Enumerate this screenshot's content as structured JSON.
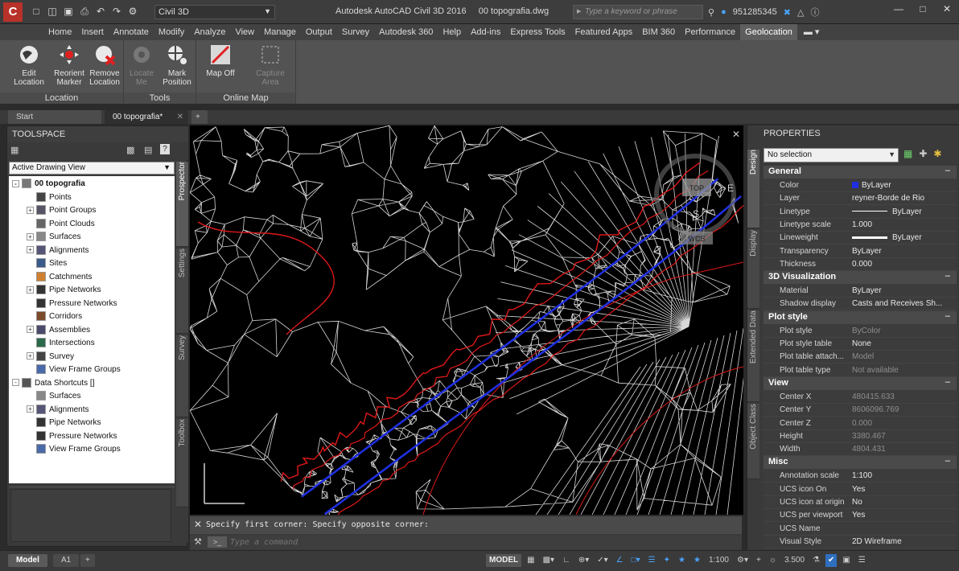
{
  "app": {
    "title": "Autodesk AutoCAD Civil 3D 2016",
    "document": "00 topografia.dwg",
    "workspace": "Civil 3D",
    "search_placeholder": "Type a keyword or phrase",
    "user_id": "951285345",
    "logo_letter": "C"
  },
  "ribbon_tabs": [
    {
      "label": "Home"
    },
    {
      "label": "Insert"
    },
    {
      "label": "Annotate"
    },
    {
      "label": "Modify"
    },
    {
      "label": "Analyze"
    },
    {
      "label": "View"
    },
    {
      "label": "Manage"
    },
    {
      "label": "Output"
    },
    {
      "label": "Survey"
    },
    {
      "label": "Autodesk 360"
    },
    {
      "label": "Help"
    },
    {
      "label": "Add-ins"
    },
    {
      "label": "Express Tools"
    },
    {
      "label": "Featured Apps"
    },
    {
      "label": "BIM 360"
    },
    {
      "label": "Performance"
    },
    {
      "label": "Geolocation",
      "active": true
    }
  ],
  "ribbon": {
    "location": {
      "label": "Location",
      "edit": "Edit Location",
      "reorient": "Reorient Marker",
      "remove": "Remove Location"
    },
    "tools": {
      "label": "Tools",
      "locate": "Locate Me",
      "mark": "Mark Position"
    },
    "online_map": {
      "label": "Online Map",
      "map_off": "Map Off",
      "capture": "Capture Area"
    }
  },
  "doc_tabs": {
    "start": "Start",
    "active": "00 topografia*"
  },
  "toolspace": {
    "title": "TOOLSPACE",
    "view": "Active Drawing View",
    "tree": [
      {
        "label": "00 topografia",
        "level": 0,
        "exp": "-",
        "bold": true,
        "icon": "drawing-icon"
      },
      {
        "label": "Points",
        "level": 1,
        "exp": "",
        "icon": "points-icon"
      },
      {
        "label": "Point Groups",
        "level": 1,
        "exp": "+",
        "icon": "point-groups-icon"
      },
      {
        "label": "Point Clouds",
        "level": 1,
        "exp": "",
        "icon": "point-clouds-icon"
      },
      {
        "label": "Surfaces",
        "level": 1,
        "exp": "+",
        "icon": "surfaces-icon"
      },
      {
        "label": "Alignments",
        "level": 1,
        "exp": "+",
        "icon": "alignments-icon"
      },
      {
        "label": "Sites",
        "level": 1,
        "exp": "",
        "icon": "sites-icon"
      },
      {
        "label": "Catchments",
        "level": 1,
        "exp": "",
        "icon": "catchments-icon"
      },
      {
        "label": "Pipe Networks",
        "level": 1,
        "exp": "+",
        "icon": "pipe-networks-icon"
      },
      {
        "label": "Pressure Networks",
        "level": 1,
        "exp": "",
        "icon": "pressure-networks-icon"
      },
      {
        "label": "Corridors",
        "level": 1,
        "exp": "",
        "icon": "corridors-icon"
      },
      {
        "label": "Assemblies",
        "level": 1,
        "exp": "+",
        "icon": "assemblies-icon"
      },
      {
        "label": "Intersections",
        "level": 1,
        "exp": "",
        "icon": "intersections-icon"
      },
      {
        "label": "Survey",
        "level": 1,
        "exp": "+",
        "icon": "survey-icon"
      },
      {
        "label": "View Frame Groups",
        "level": 1,
        "exp": "",
        "icon": "view-frame-groups-icon"
      },
      {
        "label": "Data Shortcuts []",
        "level": 0,
        "exp": "-",
        "bold": false,
        "icon": "data-shortcuts-icon"
      },
      {
        "label": "Surfaces",
        "level": 1,
        "exp": "",
        "icon": "surfaces-icon"
      },
      {
        "label": "Alignments",
        "level": 1,
        "exp": "+",
        "icon": "alignments-icon"
      },
      {
        "label": "Pipe Networks",
        "level": 1,
        "exp": "",
        "icon": "pipe-networks-icon"
      },
      {
        "label": "Pressure Networks",
        "level": 1,
        "exp": "",
        "icon": "pressure-networks-icon"
      },
      {
        "label": "View Frame Groups",
        "level": 1,
        "exp": "",
        "icon": "view-frame-groups-icon"
      }
    ],
    "side_tabs": [
      "Prospector",
      "Settings",
      "Survey",
      "Toolbox"
    ]
  },
  "viewport": {
    "viewcube_top": "TOP",
    "compass_e": "E",
    "compass_s": "S",
    "wcs": "WCS"
  },
  "command": {
    "history": "Specify first corner: Specify opposite corner:",
    "placeholder": "Type a command"
  },
  "properties": {
    "title": "PROPERTIES",
    "selection": "No selection",
    "side_tabs": [
      "Design",
      "Display",
      "Extended Data",
      "Object Class"
    ],
    "categories": [
      {
        "name": "General",
        "rows": [
          {
            "k": "Color",
            "v": "ByLayer",
            "swatch": "#1f2fe0"
          },
          {
            "k": "Layer",
            "v": "reyner-Borde de Rio"
          },
          {
            "k": "Linetype",
            "v": "ByLayer",
            "line": "thin"
          },
          {
            "k": "Linetype scale",
            "v": "1.000"
          },
          {
            "k": "Lineweight",
            "v": "ByLayer",
            "line": "thick"
          },
          {
            "k": "Transparency",
            "v": "ByLayer"
          },
          {
            "k": "Thickness",
            "v": "0.000"
          }
        ]
      },
      {
        "name": "3D Visualization",
        "rows": [
          {
            "k": "Material",
            "v": "ByLayer"
          },
          {
            "k": "Shadow display",
            "v": "Casts and Receives Sh..."
          }
        ]
      },
      {
        "name": "Plot style",
        "rows": [
          {
            "k": "Plot style",
            "v": "ByColor",
            "dim": true
          },
          {
            "k": "Plot style table",
            "v": "None"
          },
          {
            "k": "Plot table attach...",
            "v": "Model",
            "dim": true
          },
          {
            "k": "Plot table type",
            "v": "Not available",
            "dim": true
          }
        ]
      },
      {
        "name": "View",
        "rows": [
          {
            "k": "Center X",
            "v": "480415.633",
            "dim": true
          },
          {
            "k": "Center Y",
            "v": "8606096.769",
            "dim": true
          },
          {
            "k": "Center Z",
            "v": "0.000",
            "dim": true
          },
          {
            "k": "Height",
            "v": "3380.467",
            "dim": true
          },
          {
            "k": "Width",
            "v": "4804.431",
            "dim": true
          }
        ]
      },
      {
        "name": "Misc",
        "rows": [
          {
            "k": "Annotation scale",
            "v": "1:100"
          },
          {
            "k": "UCS icon On",
            "v": "Yes"
          },
          {
            "k": "UCS icon at origin",
            "v": "No"
          },
          {
            "k": "UCS per viewport",
            "v": "Yes"
          },
          {
            "k": "UCS Name",
            "v": ""
          },
          {
            "k": "Visual Style",
            "v": "2D Wireframe"
          }
        ]
      }
    ]
  },
  "status": {
    "tabs": [
      "Model",
      "A1"
    ],
    "model": "MODEL",
    "scale": "1:100",
    "value": "3.500"
  },
  "colors": {
    "accent_blue": "#1f2fe0",
    "contour_red": "#e01818",
    "mesh_white": "#d8d8d8"
  }
}
